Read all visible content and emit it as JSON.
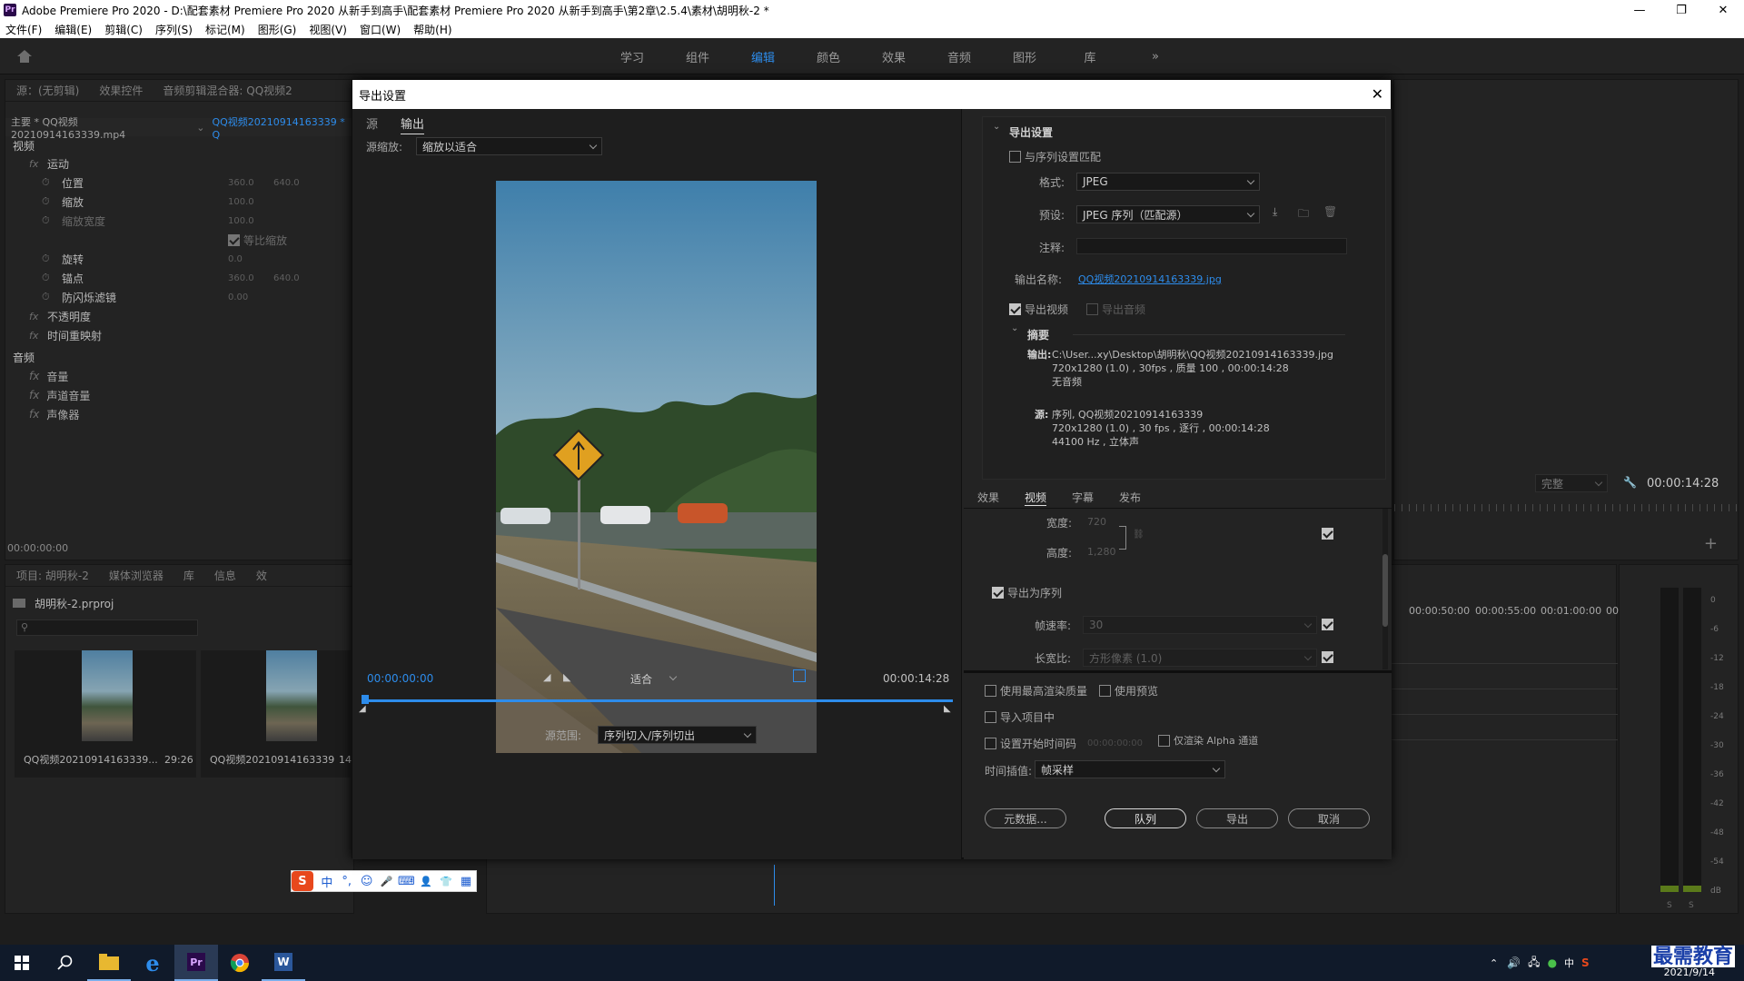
{
  "window": {
    "app_logo": "Pr",
    "title": "Adobe Premiere Pro 2020 - D:\\配套素材 Premiere Pro 2020 从新手到高手\\配套素材 Premiere Pro 2020 从新手到高手\\第2章\\2.5.4\\素材\\胡明秋-2 *"
  },
  "menu": [
    "文件(F)",
    "编辑(E)",
    "剪辑(C)",
    "序列(S)",
    "标记(M)",
    "图形(G)",
    "视图(V)",
    "窗口(W)",
    "帮助(H)"
  ],
  "workspaces": [
    "学习",
    "组件",
    "编辑",
    "颜色",
    "效果",
    "音频",
    "图形",
    "库"
  ],
  "workspaces_more": "»",
  "effect_controls": {
    "tabs": [
      "源：(无剪辑)",
      "效果控件",
      "音频剪辑混合器: QQ视频2"
    ],
    "master": "主要 * QQ视频20210914163339.mp4",
    "sequence": "QQ视频20210914163339 * Q",
    "video_header": "视频",
    "rows": [
      {
        "label": "运动",
        "v1": "",
        "v2": ""
      },
      {
        "label": "位置",
        "v1": "360.0",
        "v2": "640.0"
      },
      {
        "label": "缩放",
        "v1": "100.0",
        "v2": ""
      },
      {
        "label": "缩放宽度",
        "v1": "100.0",
        "v2": ""
      },
      {
        "label": "等比缩放",
        "v1": "",
        "v2": ""
      },
      {
        "label": "旋转",
        "v1": "0.0",
        "v2": ""
      },
      {
        "label": "锚点",
        "v1": "360.0",
        "v2": "640.0"
      },
      {
        "label": "防闪烁滤镜",
        "v1": "0.00",
        "v2": ""
      },
      {
        "label": "不透明度",
        "v1": "",
        "v2": ""
      },
      {
        "label": "时间重映射",
        "v1": "",
        "v2": ""
      }
    ],
    "audio_header": "音频",
    "audio_rows": [
      "音量",
      "声道音量",
      "声像器"
    ],
    "timecode": "00:00:00:00"
  },
  "project": {
    "tabs": [
      "项目: 胡明秋-2",
      "媒体浏览器",
      "库",
      "信息",
      "效"
    ],
    "file": "胡明秋-2.prproj",
    "items": [
      {
        "name": "QQ视频20210914163339...",
        "duration": "29:26"
      },
      {
        "name": "QQ视频20210914163339",
        "duration": "14"
      }
    ]
  },
  "ime_bar": [
    "S",
    "中",
    "°,",
    "☺",
    "🎤",
    "⌨",
    "👤",
    "👕",
    "▦"
  ],
  "program": {
    "fit": "完整",
    "timecode": "00:00:14:28"
  },
  "timeline": {
    "ruler": [
      "00:00:50:00",
      "00:00:55:00",
      "00:01:00:00",
      "00:0"
    ]
  },
  "meter": {
    "scale": [
      "0",
      "-6",
      "-12",
      "-18",
      "-24",
      "-30",
      "-36",
      "-42",
      "-48",
      "-54",
      "dB"
    ],
    "level": 0.02,
    "solo": [
      "S",
      "S"
    ]
  },
  "export_dialog": {
    "title": "导出设置",
    "close": "✕",
    "left_tabs": [
      "源",
      "输出"
    ],
    "active_left_tab": "输出",
    "source_scale_label": "源缩放:",
    "source_scale_value": "缩放以适合",
    "timecode_start": "00:00:00:00",
    "fit": "适合",
    "timecode_end": "00:00:14:28",
    "range_label": "源范围:",
    "range_value": "序列切入/序列切出",
    "export_settings_header": "导出设置",
    "match_sequence": "与序列设置匹配",
    "format_label": "格式:",
    "format_value": "JPEG",
    "preset_label": "预设:",
    "preset_value": "JPEG 序列（匹配源）",
    "comment_label": "注释:",
    "output_name_label": "输出名称:",
    "output_name_value": "QQ视频20210914163339.jpg",
    "export_video": "导出视频",
    "export_audio": "导出音频",
    "summary_header": "摘要",
    "summary_output_label": "输出:",
    "summary_output_lines": [
      "C:\\User...xy\\Desktop\\胡明秋\\QQ视频20210914163339.jpg",
      "720x1280 (1.0) , 30fps , 质量 100 , 00:00:14:28",
      "无音频"
    ],
    "summary_source_label": "源:",
    "summary_source_lines": [
      "序列, QQ视频20210914163339",
      "720x1280 (1.0) , 30 fps , 逐行 , 00:00:14:28",
      "44100 Hz , 立体声"
    ],
    "tabs": [
      "效果",
      "视频",
      "字幕",
      "发布"
    ],
    "active_tab": "视频",
    "width_label": "宽度:",
    "width_value": "720",
    "height_label": "高度:",
    "height_value": "1,280",
    "export_as_sequence": "导出为序列",
    "frame_rate_label": "帧速率:",
    "frame_rate_value": "30",
    "aspect_label": "长宽比:",
    "aspect_value": "方形像素 (1.0)",
    "max_render_quality": "使用最高渲染质量",
    "use_previews": "使用预览",
    "import_into_project": "导入项目中",
    "set_start_timecode": "设置开始时间码",
    "start_timecode_value": "00:00:00:00",
    "render_alpha_only": "仅渲染 Alpha 通道",
    "time_interp_label": "时间插值:",
    "time_interp_value": "帧采样",
    "btn_metadata": "元数据...",
    "btn_queue": "队列",
    "btn_export": "导出",
    "btn_cancel": "取消"
  },
  "taskbar": {
    "watermark": "最需教育",
    "date": "2021/9/14",
    "app_icons": [
      "windows-start",
      "search",
      "file-explorer",
      "edge",
      "premiere",
      "chrome",
      "word"
    ]
  },
  "colors": {
    "accent_blue": "#2d8ceb",
    "panel_bg": "#232323",
    "dialog_title_bg": "#ffffff"
  }
}
